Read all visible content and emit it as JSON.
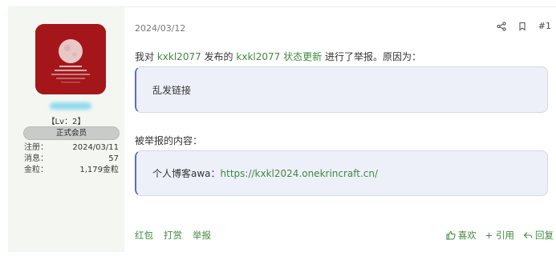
{
  "post": {
    "date": "2024/03/12",
    "floor": "#1",
    "report_prefix": "我对",
    "reported_user": "kxkl2077",
    "publish_text": "发布的",
    "author_user": "kxkl2077",
    "status_update": "状态更新",
    "report_suffix": "进行了举报。原因为：",
    "reason": "乱发链接",
    "content_label": "被举报的内容：",
    "content_prefix": "个人博客awa：",
    "content_url": "https://kxkl2024.onekrincraft.cn/"
  },
  "user": {
    "level": "【Lv：2】",
    "group": "正式会员",
    "stats": [
      {
        "key": "注册：",
        "value": "2024/03/11"
      },
      {
        "key": "消息：",
        "value": "57"
      },
      {
        "key": "金粒：",
        "value": "1,179金粒"
      }
    ]
  },
  "actions": {
    "left": [
      "红包",
      "打赏",
      "举报"
    ],
    "like": "喜欢",
    "quote": "+ 引用",
    "reply": "回复"
  },
  "colors": {
    "accent": "#3f8a3f",
    "sidebar_bg": "#f4f7f1",
    "quote_bg": "#eef0f9",
    "quote_bar": "#5b6fb6"
  }
}
